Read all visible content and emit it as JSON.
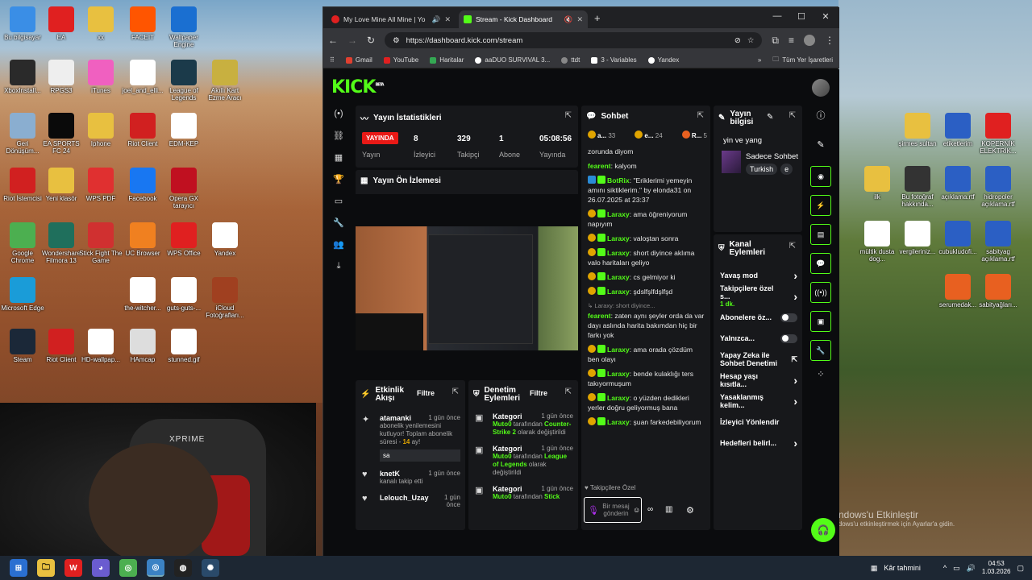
{
  "desktop": {
    "left_icons": [
      {
        "label": "Bu bilgisayar",
        "color": "#3a8ee6"
      },
      {
        "label": "EA",
        "color": "#e02020"
      },
      {
        "label": "xx",
        "color": "#e8c040"
      },
      {
        "label": "FACEIT",
        "color": "#ff5500"
      },
      {
        "label": "Wallpaper Engine",
        "color": "#1a6fd1"
      },
      {
        "label": "XboxInstall...",
        "color": "#2a2a2a"
      },
      {
        "label": "RPGS3",
        "color": "#eeeeee"
      },
      {
        "label": "iTunes",
        "color": "#f060c0"
      },
      {
        "label": "joel_and_elli...",
        "color": "#ffffff"
      },
      {
        "label": "League of Legends",
        "color": "#1b3a4a"
      },
      {
        "label": "Akıllı Kart Ezme Aracı",
        "color": "#c8b040"
      },
      {
        "label": "Geri Dönüşüm...",
        "color": "#8aaed0"
      },
      {
        "label": "EA SPORTS FC 24",
        "color": "#0a0a0a"
      },
      {
        "label": "Iphone",
        "color": "#e8c040"
      },
      {
        "label": "Riot Client",
        "color": "#d12020"
      },
      {
        "label": "EDM-KEP",
        "color": "#ffffff"
      },
      {
        "label": "Riot İstemcisi",
        "color": "#d12020"
      },
      {
        "label": "Yeni klasör",
        "color": "#e8c040"
      },
      {
        "label": "WPS PDF",
        "color": "#e03030"
      },
      {
        "label": "Facebook",
        "color": "#1877f2"
      },
      {
        "label": "Opera GX tarayıcı",
        "color": "#c01020"
      },
      {
        "label": "Google Chrome",
        "color": "#4caf50"
      },
      {
        "label": "Wondershare Filmora 13",
        "color": "#1f6f5c"
      },
      {
        "label": "Stick Fight The Game",
        "color": "#d03030"
      },
      {
        "label": "UC Browser",
        "color": "#f08020"
      },
      {
        "label": "WPS Office",
        "color": "#e02020"
      },
      {
        "label": "Yandex",
        "color": "#ffffff"
      },
      {
        "label": "Microsoft Edge",
        "color": "#1a9cd8"
      },
      {
        "label": "the-witcher...",
        "color": "#ffffff"
      },
      {
        "label": "guts-guts-...",
        "color": "#ffffff"
      },
      {
        "label": "iCloud Fotoğrafları...",
        "color": "#a04020"
      },
      {
        "label": "Steam",
        "color": "#1b2838"
      },
      {
        "label": "Riot Client",
        "color": "#d12020"
      },
      {
        "label": "HD-wallpap...",
        "color": "#ffffff"
      },
      {
        "label": "HAmcap",
        "color": "#dddddd"
      },
      {
        "label": "stunned.gif",
        "color": "#ffffff"
      }
    ],
    "right_icons": [
      {
        "label": "şirmes sultan",
        "color": "#e8c040"
      },
      {
        "label": "etiketlerim",
        "color": "#2b5fc4"
      },
      {
        "label": "KOPERNİK ELEKTRİK...",
        "color": "#e02020"
      },
      {
        "label": "ilk",
        "color": "#e8c040"
      },
      {
        "label": "Bu fotoğraf hakkında...",
        "color": "#333333"
      },
      {
        "label": "açıklama.rtf",
        "color": "#2b5fc4"
      },
      {
        "label": "hidropoler açıklama.rtf",
        "color": "#2b5fc4"
      },
      {
        "label": "mültik dusta dog...",
        "color": "#ffffff"
      },
      {
        "label": "vergileriniz...",
        "color": "#ffffff"
      },
      {
        "label": "cubukludofi...",
        "color": "#2b5fc4"
      },
      {
        "label": "sabityag açıklama.rtf",
        "color": "#2b5fc4"
      },
      {
        "label": "serumedak...",
        "color": "#e86020"
      },
      {
        "label": "sabityağları...",
        "color": "#e86020"
      }
    ],
    "watermark_title": "Windows'u Etkinleştir",
    "watermark_sub": "Windows'u etkinleştirmek için Ayarlar'a gidin."
  },
  "webcam": {
    "brand": "XPRIME"
  },
  "browser": {
    "tabs": [
      {
        "title": "My Love Mine All Mine | Yo",
        "favicon": "#e02020",
        "active": false
      },
      {
        "title": "Stream - Kick Dashboard",
        "favicon": "#53fc18",
        "active": true
      }
    ],
    "new_tab": "+",
    "url": "https://dashboard.kick.com/stream",
    "bookmarks": [
      {
        "label": "Gmail",
        "color": "#e04030"
      },
      {
        "label": "YouTube",
        "color": "#e02020"
      },
      {
        "label": "Haritalar",
        "color": "#34a853"
      },
      {
        "label": "aaDUO SURVIVAL 3...",
        "color": "#ffffff"
      },
      {
        "label": "ttdt",
        "color": "#888888"
      },
      {
        "label": "3 - Variables",
        "color": "#ffffff"
      },
      {
        "label": "Yandex",
        "color": "#ffffff"
      }
    ],
    "bookmarks_more": "»",
    "all_bookmarks": "Tüm Yer İşaretleri"
  },
  "kick": {
    "logo": "KICK",
    "logo_sup": "BETA",
    "stats": {
      "title": "Yayın İstatistikleri",
      "live": "YAYINDA",
      "live_sub": "Yayın",
      "items": [
        {
          "value": "8",
          "label": "İzleyici"
        },
        {
          "value": "329",
          "label": "Takipçi"
        },
        {
          "value": "1",
          "label": "Abone"
        },
        {
          "value": "05:08:56",
          "label": "Yayında"
        }
      ]
    },
    "preview_title": "Yayın Ön İzlemesi",
    "activity": {
      "title": "Etkinlik Akışı",
      "filter": "Filtre",
      "items": [
        {
          "name": "atamanki",
          "time": "1 gün önce",
          "text": "abonelik yenilemesini kutluyor! Toplam abonelik süresi - ",
          "months": "14",
          "months_suffix": " ay!",
          "reply": "sa"
        },
        {
          "name": "knetK",
          "time": "1 gün önce",
          "text": "kanalı takip etti"
        },
        {
          "name": "Lelouch_Uzay",
          "time": "1 gün önce",
          "text": ""
        }
      ]
    },
    "moderation": {
      "title": "Denetim Eylemleri",
      "filter": "Filtre",
      "items": [
        {
          "type": "Kategori",
          "time": "1 gün önce",
          "by": "Muto0",
          "mid": " tarafından ",
          "game": "Counter-Strike 2",
          "end": " olarak değiştirildi"
        },
        {
          "type": "Kategori",
          "time": "1 gün önce",
          "by": "Muto0",
          "mid": " tarafından ",
          "game": "League of Legends",
          "end": " olarak değiştirildi"
        },
        {
          "type": "Kategori",
          "time": "1 gün önce",
          "by": "Muto0",
          "mid": " tarafından ",
          "game": "Stick",
          "end": ""
        }
      ]
    },
    "chat": {
      "title": "Sohbet",
      "top": [
        {
          "name": "a...",
          "count": "33"
        },
        {
          "name": "e...",
          "count": "24"
        },
        {
          "name": "R...",
          "count": "5"
        }
      ],
      "messages": [
        {
          "user": "",
          "color": "#e6e6e6",
          "text": "zorunda diyom",
          "badges": []
        },
        {
          "user": "fearent",
          "color": "#53fc18",
          "text": ": kalyom",
          "badges": []
        },
        {
          "user": "BotRix",
          "color": "#53fc18",
          "text": ": \"Eriklerimi yemeyin amını siktiklerim.\" by elonda31 on 26.07.2025 at 23:37",
          "badges": [
            "b",
            "g"
          ]
        },
        {
          "user": "Laraxy",
          "color": "#53fc18",
          "text": ": ama öğreniyorum napıyım",
          "badges": [
            "y",
            "g"
          ]
        },
        {
          "user": "Laraxy",
          "color": "#53fc18",
          "text": ": valoştan sonra",
          "badges": [
            "y",
            "g"
          ]
        },
        {
          "user": "Laraxy",
          "color": "#53fc18",
          "text": ": short diyince aklıma valo haritaları geliyo",
          "badges": [
            "y",
            "g"
          ]
        },
        {
          "user": "Laraxy",
          "color": "#53fc18",
          "text": ": cs gelmiyor ki",
          "badges": [
            "y",
            "g"
          ]
        },
        {
          "user": "Laraxy",
          "color": "#53fc18",
          "text": ": şdslfşlfdşlfşd",
          "badges": [
            "y",
            "g"
          ]
        },
        {
          "user": "fearent",
          "color": "#53fc18",
          "text": ": zaten aynı şeyler orda da var dayı aslında harita bakımdan hiç bir farkı yok",
          "badges": [],
          "reply": "Laraxy: short diyince..."
        },
        {
          "user": "Laraxy",
          "color": "#53fc18",
          "text": ": ama orada çözdüm ben olayı",
          "badges": [
            "y",
            "g"
          ]
        },
        {
          "user": "Laraxy",
          "color": "#53fc18",
          "text": ": bende kulaklığı ters takıyormuşum",
          "badges": [
            "y",
            "g"
          ]
        },
        {
          "user": "Laraxy",
          "color": "#53fc18",
          "text": ": o yüzden dedikleri yerler doğru geliyormuş bana",
          "badges": [
            "y",
            "g"
          ]
        },
        {
          "user": "Laraxy",
          "color": "#53fc18",
          "text": ": şuan farkedebiliyorum",
          "badges": [
            "y",
            "g"
          ]
        }
      ],
      "mode": "Takipçilere Özel",
      "placeholder": "Bir mesaj gönderin"
    },
    "info": {
      "title": "Yayın bilgisi",
      "stream_title": "yin ve yang",
      "category": "Sadece Sohbet",
      "tags": [
        "Turkish",
        "e"
      ]
    },
    "channel_actions": {
      "title": "Kanal Eylemleri",
      "items": [
        {
          "label": "Yavaş mod",
          "kind": "arrow"
        },
        {
          "label": "Takipçilere özel s...",
          "sub": "1 dk.",
          "kind": "arrow"
        },
        {
          "label": "Abonelere öz...",
          "kind": "toggle"
        },
        {
          "label": "Yalnızca...",
          "kind": "toggle"
        },
        {
          "label": "Yapay Zeka ile Sohbet Denetimi",
          "kind": "ext"
        },
        {
          "label": "Hesap yaşı kısıtla...",
          "kind": "arrow"
        },
        {
          "label": "Yasaklanmış kelim...",
          "kind": "arrow"
        },
        {
          "label": "İzleyici Yönlendir",
          "kind": "none"
        },
        {
          "label": "Hedefleri belirl...",
          "kind": "arrow"
        }
      ]
    }
  },
  "taskbar": {
    "weather": "Kâr tahmini",
    "time": "04:53",
    "date": "1.03.2026"
  }
}
